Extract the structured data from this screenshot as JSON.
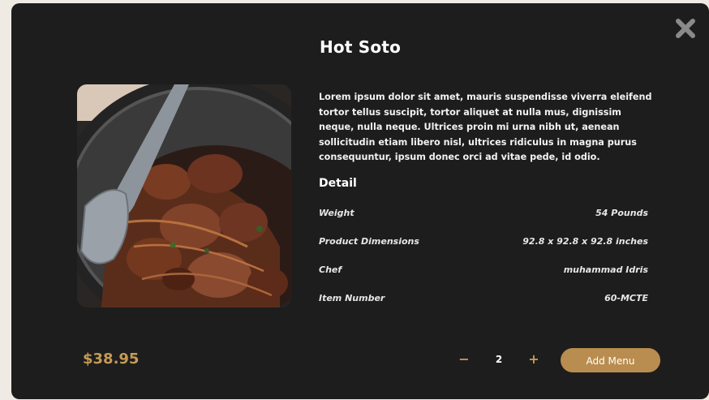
{
  "product": {
    "title": "Hot Soto",
    "description": "Lorem ipsum dolor sit amet, mauris suspendisse viverra eleifend tortor tellus suscipit, tortor aliquet at nulla mus, dignissim neque, nulla neque. Ultrices proin mi urna nibh ut, aenean sollicitudin etiam libero nisl, ultrices ridiculus in magna purus consequuntur, ipsum donec orci ad vitae pede, id odio.",
    "detail_heading": "Detail",
    "specs": [
      {
        "label": "Weight",
        "value": "54 Pounds"
      },
      {
        "label": "Product Dimensions",
        "value": "92.8 x 92.8 x 92.8 inches"
      },
      {
        "label": "Chef",
        "value": "muhammad Idris"
      },
      {
        "label": "Item Number",
        "value": "60-MCTE"
      }
    ],
    "price": "$38.95"
  },
  "quantity": {
    "minus_label": "−",
    "value": "2",
    "plus_label": "+"
  },
  "actions": {
    "add_label": "Add Menu"
  },
  "icons": {
    "close": "close-icon",
    "image": "food-photo"
  },
  "colors": {
    "background": "#1d1d1d",
    "accent": "#c69a53",
    "button": "#b98d4f",
    "page": "#efebe4"
  }
}
